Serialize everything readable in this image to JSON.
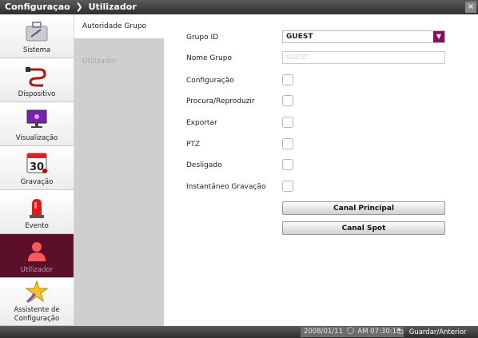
{
  "window": {
    "title": "Configuraçao",
    "breadcrumb_sep": "❯",
    "current_section": "Utilizador",
    "close_icon": "×"
  },
  "sidebar": {
    "items": [
      {
        "label": "Sistema",
        "icon": "toolbox-icon"
      },
      {
        "label": "Dispositivo",
        "icon": "cable-icon"
      },
      {
        "label": "Visualização",
        "icon": "monitor-icon"
      },
      {
        "label": "Gravação",
        "icon": "calendar-icon",
        "calendar_day": "30"
      },
      {
        "label": "Evento",
        "icon": "siren-icon"
      },
      {
        "label": "Utilizador",
        "icon": "user-icon"
      },
      {
        "label": "Assistente de Configuração",
        "icon": "wizard-star-icon"
      }
    ],
    "active_index": 5
  },
  "tabs": [
    {
      "label": "Autoridade Grupo",
      "selected": true
    },
    {
      "label": "Utilizador",
      "selected": false
    }
  ],
  "form": {
    "grupo_id_label": "Grupo ID",
    "grupo_id_value": "GUEST",
    "nome_grupo_label": "Nome Grupo",
    "nome_grupo_value": "GUEST",
    "permissions": [
      {
        "label": "Configuração",
        "checked": false
      },
      {
        "label": "Procura/Reproduzir",
        "checked": false
      },
      {
        "label": "Exportar",
        "checked": false
      },
      {
        "label": "PTZ",
        "checked": false
      },
      {
        "label": "Desligado",
        "checked": false
      },
      {
        "label": "Instantâneo Gravação",
        "checked": false
      }
    ],
    "canal_principal_label": "Canal Principal",
    "canal_spot_label": "Canal Spot"
  },
  "status": {
    "date": "2008/01/11",
    "time": "AM 07:30:10",
    "clock_icon": "clock-icon",
    "back_icon": "return-arrow-icon",
    "save_back_label": "Guardar/Anterior"
  },
  "colors": {
    "active_sidebar": "#5c0f2a",
    "dropdown_arrow": "#8a0f5a"
  }
}
